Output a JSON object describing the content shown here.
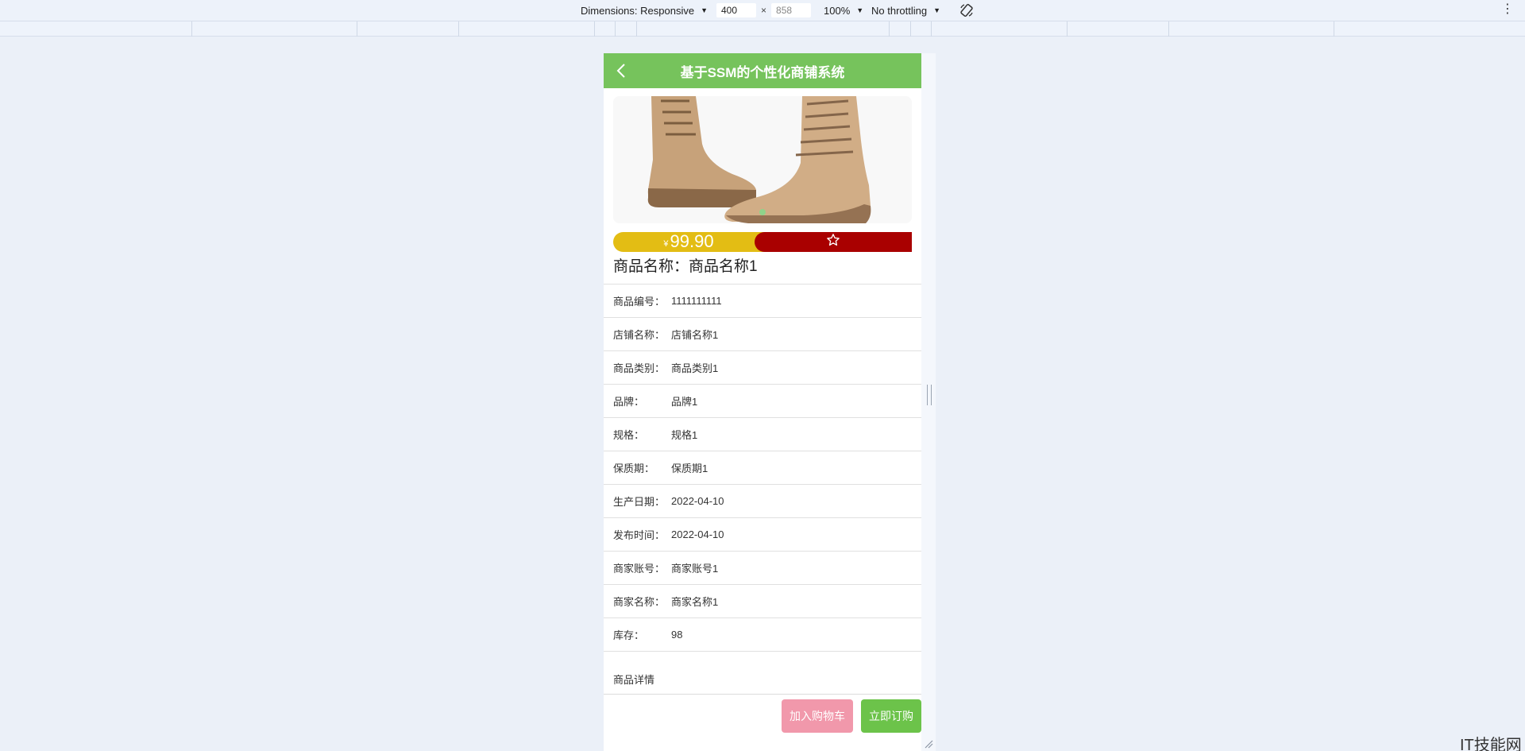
{
  "devtools": {
    "dimensions_label": "Dimensions: Responsive",
    "width": "400",
    "height": "858",
    "zoom": "100%",
    "throttling": "No throttling",
    "times": "×"
  },
  "app": {
    "title": "基于SSM的个性化商铺系统",
    "price_symbol": "¥",
    "price": "99.90",
    "product_name": "商品名称：商品名称1",
    "attributes": [
      {
        "label": "商品编号：",
        "value": "1111111111"
      },
      {
        "label": "店铺名称：",
        "value": "店铺名称1"
      },
      {
        "label": "商品类别：",
        "value": "商品类别1"
      },
      {
        "label": "品牌：",
        "value": "品牌1"
      },
      {
        "label": "规格：",
        "value": "规格1"
      },
      {
        "label": "保质期：",
        "value": "保质期1"
      },
      {
        "label": "生产日期：",
        "value": "2022-04-10"
      },
      {
        "label": "发布时间：",
        "value": "2022-04-10"
      },
      {
        "label": "商家账号：",
        "value": "商家账号1"
      },
      {
        "label": "商家名称：",
        "value": "商家名称1"
      },
      {
        "label": "库存：",
        "value": "98"
      }
    ],
    "detail_label": "商品详情",
    "add_to_cart": "加入购物车",
    "buy_now": "立即订购"
  },
  "watermark": "IT技能网",
  "colors": {
    "header": "#76c35c",
    "price": "#e3bd14",
    "favorite": "#a90000",
    "cart_button": "#f198ab",
    "buy_button": "#6cc34a"
  },
  "icons": {
    "back": "chevron-left-icon",
    "favorite": "star-outline-icon",
    "rotate": "rotate-device-icon",
    "more": "vertical-dots-icon"
  }
}
